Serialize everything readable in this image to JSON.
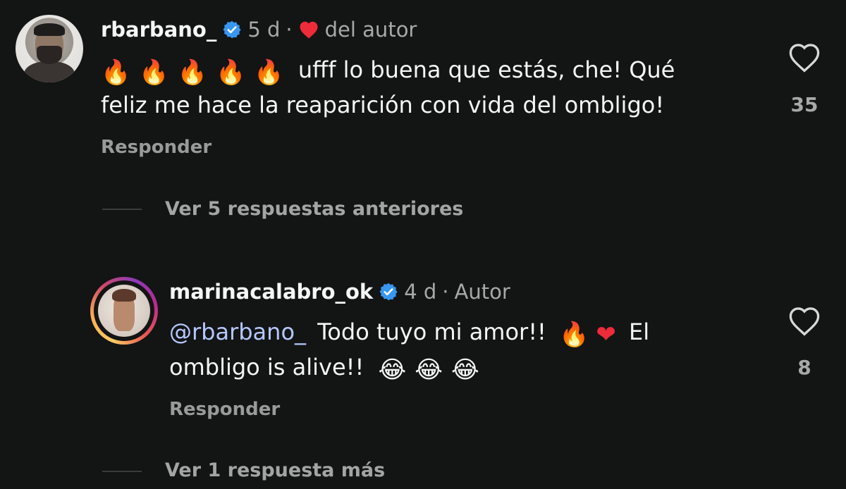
{
  "comments": [
    {
      "username": "rbarbano_",
      "time": "5 d",
      "dot": "·",
      "liked_label": "del autor",
      "text_line1": "ufff lo buena que estás, che! Qué",
      "text_line2": "feliz me hace la reaparición con vida del ombligo!",
      "reply_label": "Responder",
      "likes": "35",
      "view_replies": "Ver 5 respuestas anteriores"
    },
    {
      "username": "marinacalabro_ok",
      "time": "4 d",
      "dot": "·",
      "author_label": "Autor",
      "mention": "@rbarbano_",
      "text_line1": "Todo tuyo mi amor!!",
      "text_line1b": "El",
      "text_line2": "ombligo is alive!!",
      "reply_label": "Responder",
      "likes": "8",
      "view_replies": "Ver 1 respuesta más"
    }
  ],
  "emoji": {
    "fire": "🔥",
    "red_heart": "❤",
    "laughing": "😂"
  },
  "colors": {
    "background": "#131414",
    "verified": "#3897f0",
    "heart_red": "#ed2b3a",
    "mention": "#b5c8ff"
  }
}
